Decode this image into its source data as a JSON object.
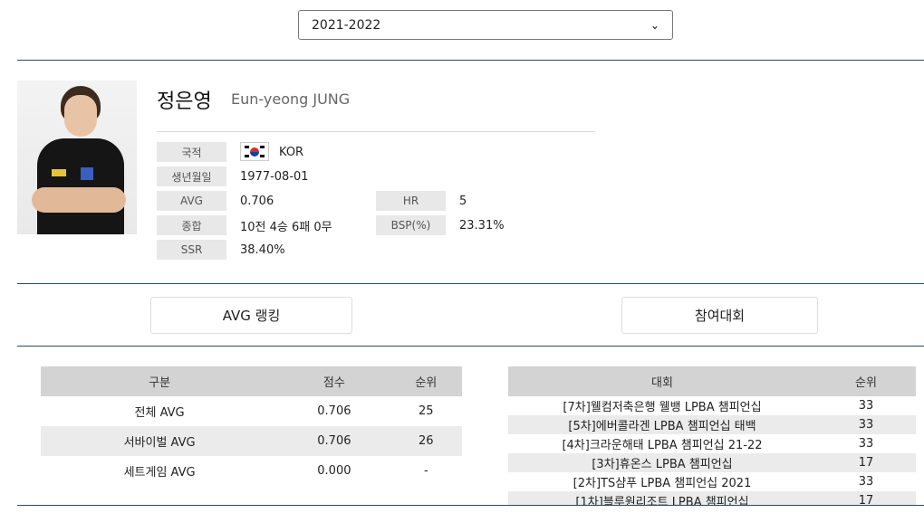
{
  "season_select": {
    "value": "2021-2022"
  },
  "player": {
    "name_ko": "정은영",
    "name_en": "Eun-yeong JUNG",
    "photo_icon": "player-photo",
    "fields": {
      "nationality_label": "국적",
      "nationality_value": "KOR",
      "nationality_flag": "south-korea-flag-icon",
      "birth_label": "생년월일",
      "birth_value": "1977-08-01",
      "avg_label": "AVG",
      "avg_value": "0.706",
      "hr_label": "HR",
      "hr_value": "5",
      "record_label": "종합",
      "record_value": "10전 4승 6패 0무",
      "bsp_label": "BSP(%)",
      "bsp_value": "23.31%",
      "ssr_label": "SSR",
      "ssr_value": "38.40%"
    }
  },
  "tabs": {
    "avg_ranking": "AVG 랭킹",
    "competitions": "참여대회"
  },
  "avg_table": {
    "headers": [
      "구분",
      "점수",
      "순위"
    ],
    "rows": [
      [
        "전체 AVG",
        "0.706",
        "25"
      ],
      [
        "서바이벌 AVG",
        "0.706",
        "26"
      ],
      [
        "세트게임 AVG",
        "0.000",
        "-"
      ]
    ]
  },
  "comp_table": {
    "headers": [
      "대회",
      "순위"
    ],
    "rows": [
      [
        "[7차]웰컴저축은행 웰뱅 LPBA 챔피언십",
        "33"
      ],
      [
        "[5차]에버콜라겐 LPBA 챔피언십 태백",
        "33"
      ],
      [
        "[4차]크라운해태 LPBA 챔피언십 21-22",
        "33"
      ],
      [
        "[3차]휴온스 LPBA 챔피언십",
        "17"
      ],
      [
        "[2차]TS샴푸 LPBA 챔피언십 2021",
        "33"
      ],
      [
        "[1차]블루원리조트 LPBA 챔피언십",
        "17"
      ]
    ]
  },
  "colors": {
    "rule": "#2f4a5a",
    "label_bg": "#e8e8e8",
    "table_header_bg": "#d3d3d3"
  }
}
